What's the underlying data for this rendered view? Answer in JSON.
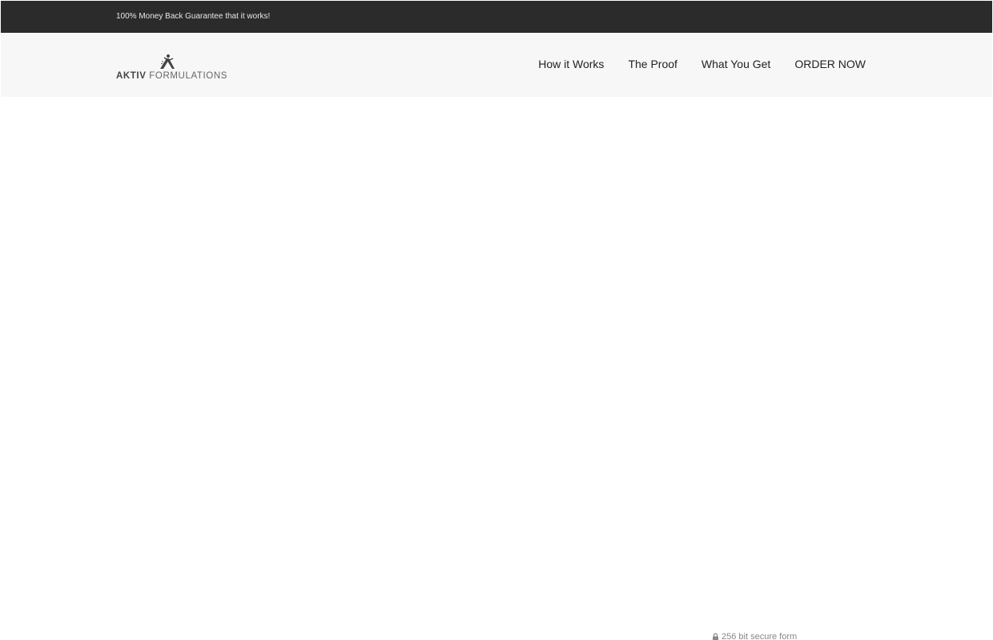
{
  "topbar": {
    "guarantee_text": "100% Money Back Guarantee that it works!"
  },
  "header": {
    "logo": {
      "icon": "leaping-figure-logo-icon",
      "word1": "AKTIV",
      "word2": "FORMULATIONS"
    },
    "nav": {
      "items": [
        {
          "label": "How it Works"
        },
        {
          "label": "The Proof"
        },
        {
          "label": "What You Get"
        },
        {
          "label": "ORDER NOW"
        }
      ]
    }
  },
  "footer_hint": {
    "icon": "lock-icon",
    "secure_text": "256 bit secure form"
  },
  "colors": {
    "topbar_bg": "#2b2b2b",
    "header_bg": "#f7f7f7",
    "nav_text": "#222222",
    "muted_text": "#888888"
  }
}
